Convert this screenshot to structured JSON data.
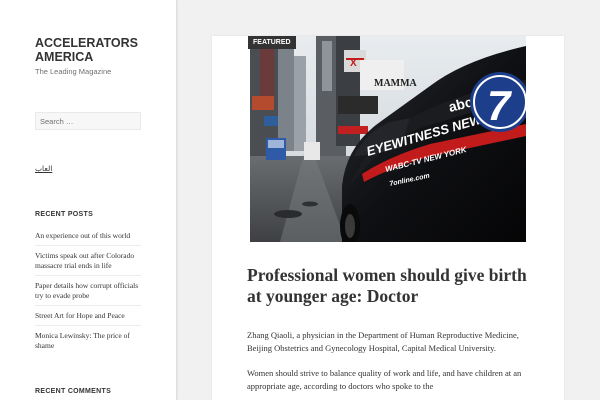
{
  "site": {
    "title": "ACCELERATORS AMERICA",
    "description": "The Leading Magazine"
  },
  "search": {
    "placeholder": "Search …"
  },
  "sidebar": {
    "arabic_link": "العاب",
    "recent_posts_title": "RECENT POSTS",
    "recent_posts": [
      "An experience out of this world",
      "Victims speak out after Colorado massacre trial ends in life",
      "Paper details how corrupt officials try to evade probe",
      "Street Art for Hope and Peace",
      "Monica Lewinsky: The price of shame"
    ],
    "recent_comments_title": "RECENT COMMENTS"
  },
  "article": {
    "badge": "FEATURED",
    "image_text": {
      "van_line1": "EYEWITNESS NEWS",
      "van_line2": "WABC-TV NEW YORK",
      "van_line3": "7online.com",
      "abc": "abc",
      "seven": "7",
      "sign": "MAMMA",
      "sign2": "X"
    },
    "title": "Professional women should give birth at younger age: Doctor",
    "paragraphs": [
      "Zhang Qiaoli, a physician in the Department of Human Reproductive Medicine, Beijing Obstetrics and Gynecology Hospital, Capital Medical University.",
      "Women should strive to balance quality of work and life, and have children at an appropriate age, according to doctors who spoke to the"
    ]
  },
  "colors": {
    "sidebar_bg": "#ffffff",
    "page_bg": "#f1f1f1",
    "text": "#333333",
    "muted": "#707070",
    "badge_bg": "#333333"
  }
}
